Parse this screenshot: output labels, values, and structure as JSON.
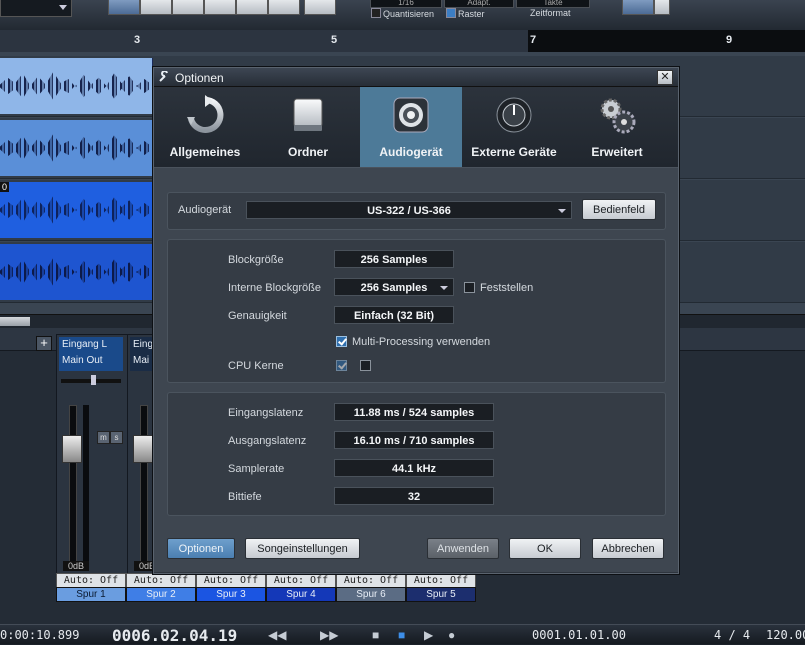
{
  "daw": {
    "toolbar": {
      "quantisieren_label": "Quantisieren",
      "raster_label": "Raster",
      "zeitformat_label": "Zeitformat",
      "pill_1": "1/16",
      "pill_2": "Adapt.",
      "pill_3": "Takte"
    },
    "ruler": [
      "3",
      "5",
      "7",
      "9"
    ],
    "tracks": [
      {
        "label": ""
      },
      {
        "label": ""
      },
      {
        "label": "0"
      },
      {
        "label": ""
      }
    ],
    "mixer": {
      "strips": [
        {
          "input": "Eingang L",
          "output": "Main Out",
          "db": "0dB"
        },
        {
          "input": "Eing",
          "output": "Mai",
          "db": "0dB"
        }
      ],
      "auto_labels": [
        "Auto: Off",
        "Auto: Off",
        "Auto: Off",
        "Auto: Off",
        "Auto: Off",
        "Auto: Off"
      ],
      "spur_labels": [
        "Spur 1",
        "Spur 2",
        "Spur 3",
        "Spur 4",
        "Spur 6",
        "Spur 5"
      ]
    },
    "transport": {
      "time": "0:00:10.899",
      "position": "0006.02.04.19",
      "loop_position": "0001.01.01.00",
      "signature": "4 / 4",
      "tempo": "120.00"
    }
  },
  "dialog": {
    "title": "Optionen",
    "categories": [
      {
        "label": "Allgemeines",
        "icon": "refresh-icon"
      },
      {
        "label": "Ordner",
        "icon": "hard-drive-icon"
      },
      {
        "label": "Audiogerät",
        "icon": "speaker-icon"
      },
      {
        "label": "Externe Geräte",
        "icon": "knob-icon"
      },
      {
        "label": "Erweitert",
        "icon": "gears-icon"
      }
    ],
    "active_category": "Audiogerät",
    "device": {
      "label": "Audiogerät",
      "value": "US-322 / US-366",
      "control_panel_button": "Bedienfeld"
    },
    "settings": {
      "block_size_label": "Blockgröße",
      "block_size_value": "256 Samples",
      "internal_block_size_label": "Interne Blockgröße",
      "internal_block_size_value": "256 Samples",
      "fix_label": "Feststellen",
      "precision_label": "Genauigkeit",
      "precision_value": "Einfach (32 Bit)",
      "multiprocessing_label": "Multi-Processing verwenden",
      "cpu_cores_label": "CPU Kerne"
    },
    "info": {
      "input_latency_label": "Eingangslatenz",
      "input_latency_value": "11.88 ms / 524 samples",
      "output_latency_label": "Ausgangslatenz",
      "output_latency_value": "16.10 ms / 710 samples",
      "sample_rate_label": "Samplerate",
      "sample_rate_value": "44.1 kHz",
      "bit_depth_label": "Bittiefe",
      "bit_depth_value": "32"
    },
    "buttons": {
      "options": "Optionen",
      "song_settings": "Songeinstellungen",
      "apply": "Anwenden",
      "ok": "OK",
      "cancel": "Abbrechen"
    },
    "colors": {
      "active_tab": "#4d7a98",
      "primary_button": "#5a8cbf"
    }
  }
}
